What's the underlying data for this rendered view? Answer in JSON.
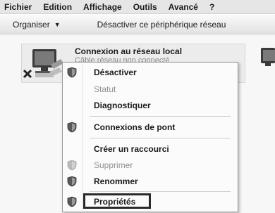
{
  "menubar": {
    "items": [
      "Fichier",
      "Edition",
      "Affichage",
      "Outils",
      "Avancé",
      "?"
    ]
  },
  "toolbar": {
    "organiser": "Organiser",
    "disable_device": "Désactiver ce périphérique réseau"
  },
  "connection": {
    "name": "Connexion au réseau local",
    "status": "Câble réseau non connecté"
  },
  "context_menu": {
    "items": [
      {
        "label": "Désactiver",
        "shield": true,
        "disabled": false
      },
      {
        "label": "Statut",
        "shield": false,
        "disabled": true
      },
      {
        "label": "Diagnostiquer",
        "shield": false,
        "disabled": false
      },
      {
        "label": "Connexions de pont",
        "shield": true,
        "disabled": false
      },
      {
        "label": "Créer un raccourci",
        "shield": false,
        "disabled": false
      },
      {
        "label": "Supprimer",
        "shield": true,
        "disabled": true
      },
      {
        "label": "Renommer",
        "shield": true,
        "disabled": false
      },
      {
        "label": "Propriétés",
        "shield": true,
        "disabled": false
      }
    ]
  },
  "icons": {
    "shield": "uac-shield-icon",
    "network": "network-adapter-icon",
    "error": "disconnected-x-icon"
  },
  "colors": {
    "highlight_border": "#2a2a2a",
    "disabled_text": "#8f8f8f"
  }
}
